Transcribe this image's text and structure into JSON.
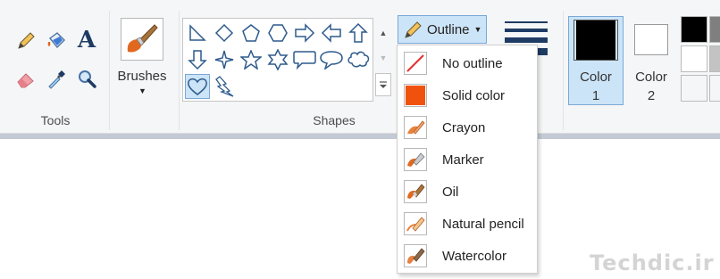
{
  "tools_group": {
    "label": "Tools",
    "tools": [
      {
        "name": "pencil",
        "icon": "pencil-icon"
      },
      {
        "name": "fill",
        "icon": "fill-bucket-icon"
      },
      {
        "name": "text",
        "icon": "text-icon",
        "glyph": "A"
      },
      {
        "name": "eraser",
        "icon": "eraser-icon"
      },
      {
        "name": "color-picker",
        "icon": "color-picker-icon"
      },
      {
        "name": "magnifier",
        "icon": "magnifier-icon"
      }
    ]
  },
  "brushes": {
    "label": "Brushes",
    "icon": "brush-icon"
  },
  "shapes_group": {
    "label": "Shapes",
    "shapes": [
      "right-triangle-icon",
      "diamond-icon",
      "pentagon-icon",
      "hexagon-icon",
      "right-arrow-icon",
      "left-arrow-icon",
      "up-arrow-icon",
      "down-arrow-icon",
      "four-point-star-icon",
      "five-point-star-icon",
      "six-point-star-icon",
      "rounded-callout-icon",
      "oval-callout-icon",
      "cloud-callout-icon",
      "heart-icon",
      "lightning-icon"
    ],
    "selected_index": 14
  },
  "outline": {
    "label": "Outline",
    "menu": [
      {
        "label": "No outline",
        "icon": "no-outline-icon"
      },
      {
        "label": "Solid color",
        "icon": "solid-color-icon"
      },
      {
        "label": "Crayon",
        "icon": "crayon-icon"
      },
      {
        "label": "Marker",
        "icon": "marker-icon"
      },
      {
        "label": "Oil",
        "icon": "oil-icon"
      },
      {
        "label": "Natural pencil",
        "icon": "natural-pencil-icon"
      },
      {
        "label": "Watercolor",
        "icon": "watercolor-icon"
      }
    ]
  },
  "colors": {
    "color1": {
      "label_line1": "Color",
      "label_line2": "1",
      "value": "#000000"
    },
    "color2": {
      "label_line1": "Color",
      "label_line2": "2",
      "value": "#ffffff"
    },
    "palette": [
      "#000000",
      "#7f7f7f",
      "#ffffff",
      "#c3c3c3",
      "#ffffff",
      "#ffffff"
    ]
  },
  "watermark": "Techdic.ir",
  "accent": "#cce4f7",
  "solid_color_swatch": "#f0520e"
}
